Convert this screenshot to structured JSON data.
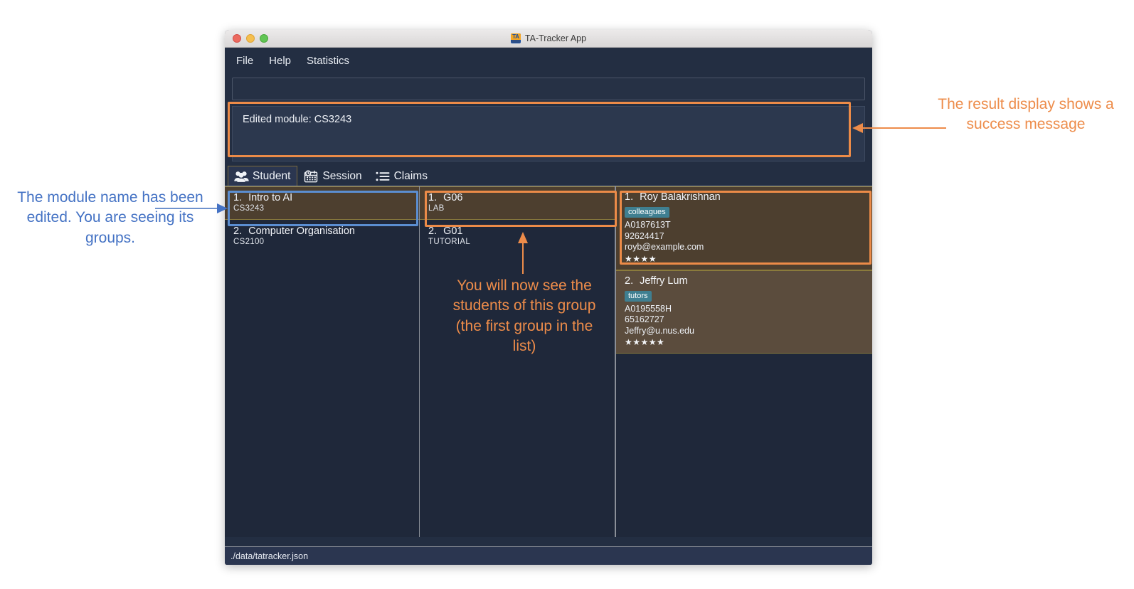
{
  "window": {
    "title": "TA-Tracker App",
    "app_icon": "ta-tracker-app-icon",
    "traffic_lights": [
      "close",
      "minimize",
      "zoom"
    ]
  },
  "menubar": {
    "items": [
      {
        "label": "File",
        "name": "menu-file"
      },
      {
        "label": "Help",
        "name": "menu-help"
      },
      {
        "label": "Statistics",
        "name": "menu-statistics"
      }
    ]
  },
  "command_box": {
    "value": "",
    "placeholder": ""
  },
  "result_display": {
    "message": "Edited module: CS3243"
  },
  "tabs": [
    {
      "label": "Student",
      "icon": "people-icon",
      "selected": true
    },
    {
      "label": "Session",
      "icon": "calendar-clock-icon",
      "selected": false
    },
    {
      "label": "Claims",
      "icon": "list-icon",
      "selected": false
    }
  ],
  "modules": [
    {
      "index": "1.",
      "name": "Intro to AI",
      "code": "CS3243",
      "selected": true
    },
    {
      "index": "2.",
      "name": "Computer Organisation",
      "code": "CS2100",
      "selected": false
    }
  ],
  "groups": [
    {
      "index": "1.",
      "name": "G06",
      "type": "LAB",
      "selected": true
    },
    {
      "index": "2.",
      "name": "G01",
      "type": "TUTORIAL",
      "selected": false
    }
  ],
  "students": [
    {
      "index": "1.",
      "name": "Roy Balakrishnan",
      "tag": "colleagues",
      "matric": "A0187613T",
      "phone": "92624417",
      "email": "royb@example.com",
      "rating": "★★★★"
    },
    {
      "index": "2.",
      "name": "Jeffry Lum",
      "tag": "tutors",
      "matric": "A0195558H",
      "phone": "65162727",
      "email": "Jeffry@u.nus.edu",
      "rating": "★★★★★"
    }
  ],
  "status_bar": {
    "path": "./data/tatracker.json"
  },
  "annotations": {
    "left": "The module name has been edited. You are seeing its groups.",
    "right": "The result display shows a success message",
    "center": "You will now see the students of this group (the first group in the list)"
  },
  "colors": {
    "accent_orange": "#ed8c4a",
    "accent_blue": "#4472c4",
    "app_bg": "#232e42",
    "panel_bg": "#1f283a",
    "card_selected": "#4d3f2f",
    "card_selected_alt": "#5b4c3d",
    "card_border_gold": "#8b7b3c",
    "tag_bg": "#3f7f91"
  }
}
